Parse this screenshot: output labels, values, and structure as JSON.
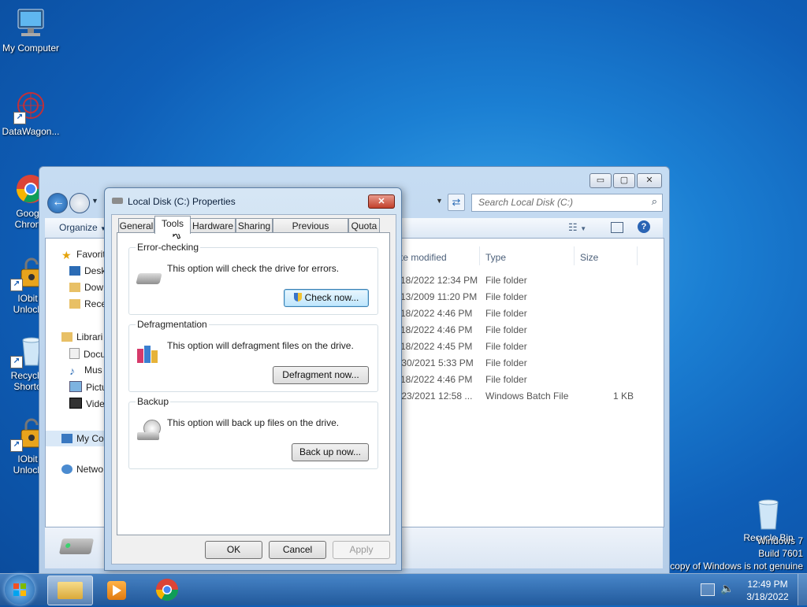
{
  "desktop": {
    "icons": [
      {
        "label": "My Computer",
        "icon": "computer-icon"
      },
      {
        "label": "DataWagon...",
        "icon": "datawagon-icon"
      },
      {
        "label": "Goog\nChron",
        "icon": "chrome-icon"
      },
      {
        "label": "IObit\nUnlock",
        "icon": "iobit-icon"
      },
      {
        "label": "Recycle\nShorto",
        "icon": "recycle-bin-icon"
      },
      {
        "label": "IObit\nUnlock",
        "icon": "iobit-icon"
      },
      {
        "label": "Recycle Bin",
        "icon": "recycle-bin-icon"
      }
    ],
    "watermark": [
      "Windows 7",
      "Build 7601",
      "copy of Windows is not genuine"
    ]
  },
  "explorer": {
    "caption_buttons": {
      "minimize": "▭",
      "maximize": "▢",
      "close": "✕"
    },
    "search_placeholder": "Search Local Disk (C:)",
    "organize_label": "Organize",
    "columns": [
      "te modified",
      "Type",
      "Size"
    ],
    "nav": {
      "favorites": "Favorit",
      "desktop": "Desk",
      "downloads": "Dow",
      "recent": "Rece",
      "libraries": "Librari",
      "documents": "Docu",
      "music": "Mus",
      "pictures": "Pictu",
      "videos": "Vide",
      "computer": "My Co",
      "network": "Netwo"
    },
    "rows": [
      {
        "date": "18/2022 12:34 PM",
        "type": "File folder",
        "size": ""
      },
      {
        "date": "13/2009 11:20 PM",
        "type": "File folder",
        "size": ""
      },
      {
        "date": "18/2022 4:46 PM",
        "type": "File folder",
        "size": ""
      },
      {
        "date": "18/2022 4:46 PM",
        "type": "File folder",
        "size": ""
      },
      {
        "date": "18/2022 4:45 PM",
        "type": "File folder",
        "size": ""
      },
      {
        "date": "/30/2021 5:33 PM",
        "type": "File folder",
        "size": ""
      },
      {
        "date": "18/2022 4:46 PM",
        "type": "File folder",
        "size": ""
      },
      {
        "date": "/23/2021 12:58 ...",
        "type": "Windows Batch File",
        "size": "1 KB"
      }
    ]
  },
  "dialog": {
    "title": "Local Disk (C:) Properties",
    "tabs": [
      "General",
      "Tools",
      "Hardware",
      "Sharing",
      "Previous Versions",
      "Quota"
    ],
    "active_tab": "Tools",
    "groups": {
      "error_checking": {
        "title": "Error-checking",
        "desc": "This option will check the drive for errors.",
        "button": "Check now..."
      },
      "defrag": {
        "title": "Defragmentation",
        "desc": "This option will defragment files on the drive.",
        "button": "Defragment now..."
      },
      "backup": {
        "title": "Backup",
        "desc": "This option will back up files on the drive.",
        "button": "Back up now..."
      }
    },
    "buttons": {
      "ok": "OK",
      "cancel": "Cancel",
      "apply": "Apply"
    }
  },
  "taskbar": {
    "time": "12:49 PM",
    "date": "3/18/2022"
  }
}
